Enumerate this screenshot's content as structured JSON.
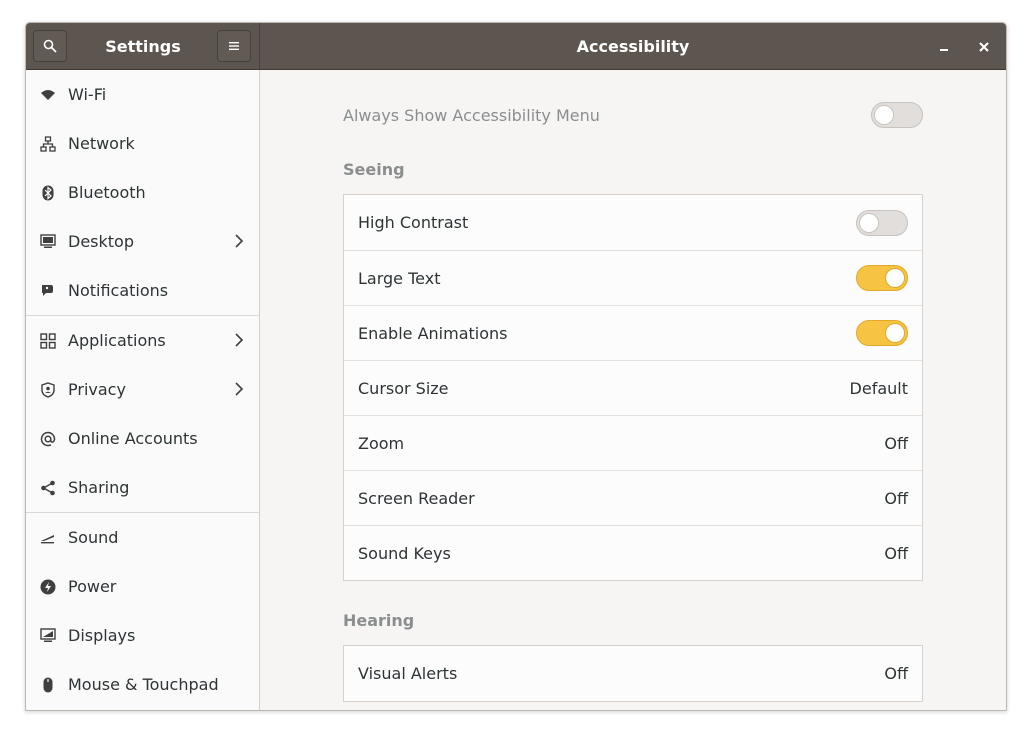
{
  "header": {
    "sidebar_title": "Settings",
    "panel_title": "Accessibility"
  },
  "sidebar": {
    "items": [
      {
        "label": "Wi-Fi",
        "icon": "wifi-icon"
      },
      {
        "label": "Network",
        "icon": "network-icon"
      },
      {
        "label": "Bluetooth",
        "icon": "bluetooth-icon"
      },
      {
        "label": "Desktop",
        "icon": "desktop-icon",
        "chevron": true
      },
      {
        "label": "Notifications",
        "icon": "notifications-icon"
      },
      {
        "label": "Applications",
        "icon": "applications-icon",
        "chevron": true
      },
      {
        "label": "Privacy",
        "icon": "privacy-icon",
        "chevron": true
      },
      {
        "label": "Online Accounts",
        "icon": "at-sign-icon"
      },
      {
        "label": "Sharing",
        "icon": "share-icon"
      },
      {
        "label": "Sound",
        "icon": "sound-icon"
      },
      {
        "label": "Power",
        "icon": "power-icon"
      },
      {
        "label": "Displays",
        "icon": "display-icon"
      },
      {
        "label": "Mouse & Touchpad",
        "icon": "mouse-icon"
      }
    ]
  },
  "main": {
    "always_show": {
      "label": "Always Show Accessibility Menu",
      "on": false
    },
    "seeing": {
      "title": "Seeing",
      "rows": [
        {
          "label": "High Contrast",
          "switch": false
        },
        {
          "label": "Large Text",
          "switch": true
        },
        {
          "label": "Enable Animations",
          "switch": true
        },
        {
          "label": "Cursor Size",
          "value": "Default"
        },
        {
          "label": "Zoom",
          "value": "Off"
        },
        {
          "label": "Screen Reader",
          "value": "Off"
        },
        {
          "label": "Sound Keys",
          "value": "Off"
        }
      ]
    },
    "hearing": {
      "title": "Hearing",
      "rows": [
        {
          "label": "Visual Alerts",
          "value": "Off"
        }
      ]
    }
  },
  "colors": {
    "headerbar": "#5c5550",
    "accent_switch_on": "#f6c343",
    "sidebar_bg": "#fafafa",
    "main_bg": "#f6f5f4"
  }
}
